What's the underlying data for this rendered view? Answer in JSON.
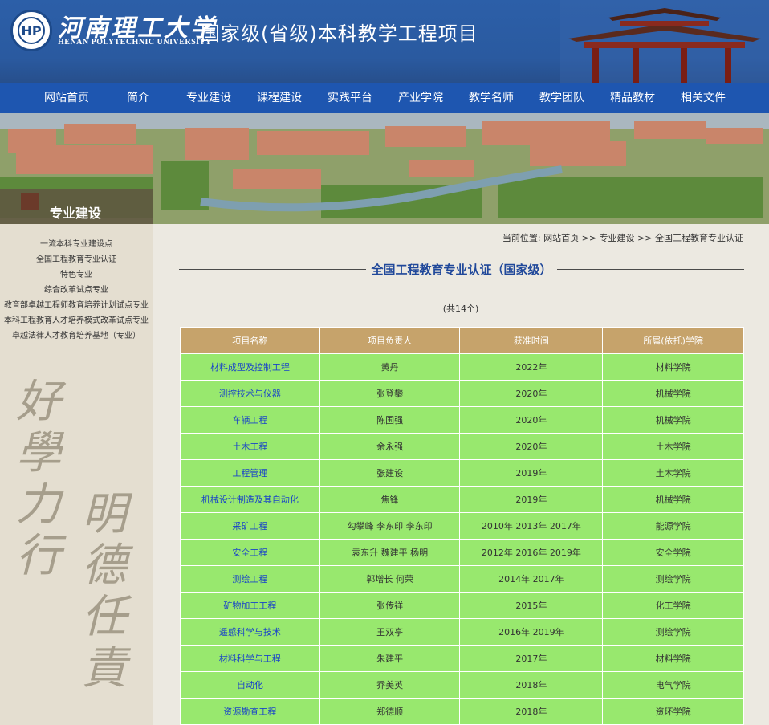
{
  "header": {
    "logo_cn": "河南理工大学",
    "logo_en": "HENAN POLYTECHNIC UNIVERSITY",
    "logo_mark": "HP",
    "title": "国家级(省级)本科教学工程项目"
  },
  "nav": [
    "网站首页",
    "简介",
    "专业建设",
    "课程建设",
    "实践平台",
    "产业学院",
    "教学名师",
    "教学团队",
    "精品教材",
    "相关文件"
  ],
  "section_label": "专业建设",
  "sidebar": {
    "items": [
      "一流本科专业建设点",
      "全国工程教育专业认证",
      "特色专业",
      "综合改革试点专业",
      "教育部卓越工程师教育培养计划试点专业",
      "本科工程教育人才培养模式改革试点专业",
      "卓越法律人才教育培养基地（专业）"
    ],
    "calligraphy_left": "好學力行",
    "calligraphy_right": "明德任責"
  },
  "breadcrumb": {
    "prefix": "当前位置:",
    "home": "网站首页",
    "sep1": ">>",
    "level1": "专业建设",
    "sep2": ">>",
    "current": "全国工程教育专业认证"
  },
  "page_title": "全国工程教育专业认证（国家级）",
  "count_text": "(共14个)",
  "table": {
    "headers": [
      "项目名称",
      "项目负责人",
      "获准时间",
      "所属(依托)学院"
    ],
    "rows": [
      [
        "材料成型及控制工程",
        "黄丹",
        "2022年",
        "材料学院"
      ],
      [
        "测控技术与仪器",
        "张登攀",
        "2020年",
        "机械学院"
      ],
      [
        "车辆工程",
        "陈国强",
        "2020年",
        "机械学院"
      ],
      [
        "土木工程",
        "余永强",
        "2020年",
        "土木学院"
      ],
      [
        "工程管理",
        "张建设",
        "2019年",
        "土木学院"
      ],
      [
        "机械设计制造及其自动化",
        "焦锋",
        "2019年",
        "机械学院"
      ],
      [
        "采矿工程",
        "勾攀峰 李东印 李东印",
        "2010年 2013年 2017年",
        "能源学院"
      ],
      [
        "安全工程",
        "袁东升 魏建平 杨明",
        "2012年 2016年 2019年",
        "安全学院"
      ],
      [
        "测绘工程",
        "郭增长 何荣",
        "2014年 2017年",
        "测绘学院"
      ],
      [
        "矿物加工工程",
        "张传祥",
        "2015年",
        "化工学院"
      ],
      [
        "遥感科学与技术",
        "王双亭",
        "2016年 2019年",
        "测绘学院"
      ],
      [
        "材料科学与工程",
        "朱建平",
        "2017年",
        "材料学院"
      ],
      [
        "自动化",
        "乔美英",
        "2018年",
        "电气学院"
      ],
      [
        "资源勘查工程",
        "郑德顺",
        "2018年",
        "资环学院"
      ]
    ]
  }
}
